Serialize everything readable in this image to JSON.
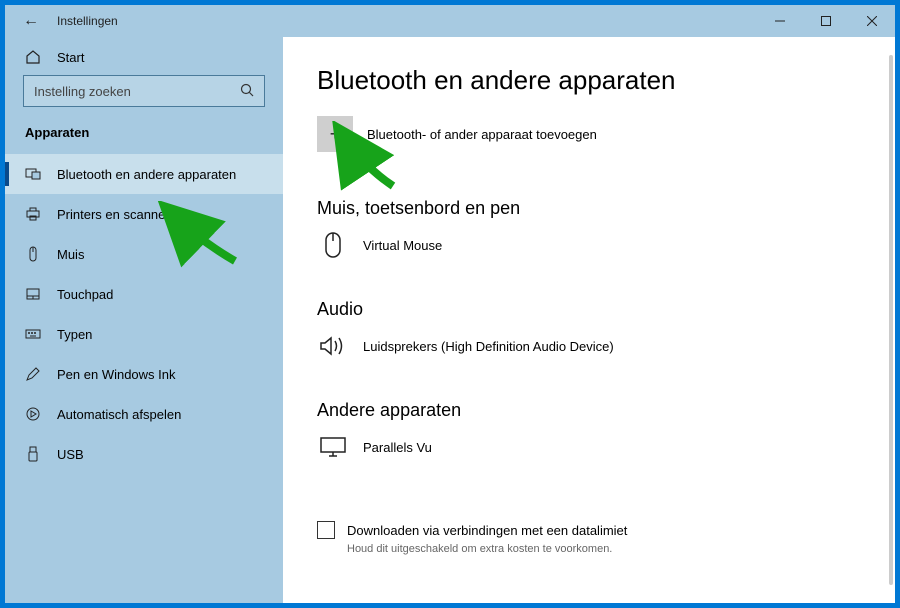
{
  "titlebar": {
    "back_icon": "←",
    "title": "Instellingen"
  },
  "sidebar": {
    "home_label": "Start",
    "search_placeholder": "Instelling zoeken",
    "section_title": "Apparaten",
    "items": [
      {
        "label": "Bluetooth en andere apparaten",
        "icon": "bluetooth"
      },
      {
        "label": "Printers en scanners",
        "icon": "printer"
      },
      {
        "label": "Muis",
        "icon": "mouse"
      },
      {
        "label": "Touchpad",
        "icon": "touchpad"
      },
      {
        "label": "Typen",
        "icon": "keyboard"
      },
      {
        "label": "Pen en Windows Ink",
        "icon": "pen"
      },
      {
        "label": "Automatisch afspelen",
        "icon": "autoplay"
      },
      {
        "label": "USB",
        "icon": "usb"
      }
    ]
  },
  "main": {
    "title": "Bluetooth en andere apparaten",
    "add_label": "Bluetooth- of ander apparaat toevoegen",
    "cat1_title": "Muis, toetsenbord en pen",
    "cat1_dev": "Virtual Mouse",
    "cat2_title": "Audio",
    "cat2_dev": "Luidsprekers (High Definition Audio Device)",
    "cat3_title": "Andere apparaten",
    "cat3_dev": "Parallels Vu",
    "download_label": "Downloaden via verbindingen met een datalimiet",
    "download_note": "Houd dit uitgeschakeld om extra kosten te voorkomen."
  }
}
